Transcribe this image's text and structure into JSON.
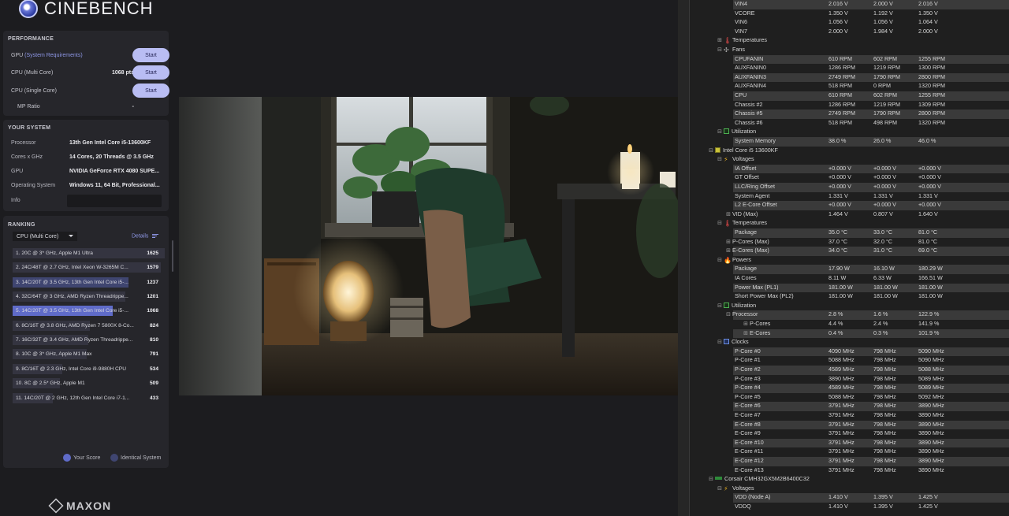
{
  "cinebench": {
    "brand": "CINEBENCH",
    "footer_brand": "MAXON",
    "performance": {
      "title": "PERFORMANCE",
      "rows": [
        {
          "label_main": "GPU ",
          "label_link": "(System Requirements)",
          "value": "-",
          "button": "Start"
        },
        {
          "label_main": "CPU (Multi Core)",
          "label_link": "",
          "value": "1068 pts",
          "button": "Start"
        },
        {
          "label_main": "CPU (Single Core)",
          "label_link": "",
          "value": "-",
          "button": "Start"
        },
        {
          "label_main": "MP Ratio",
          "label_link": "",
          "value": "-",
          "button": ""
        }
      ]
    },
    "system": {
      "title": "YOUR SYSTEM",
      "rows": [
        {
          "key": "Processor",
          "value": "13th Gen Intel Core i5-13600KF"
        },
        {
          "key": "Cores x GHz",
          "value": "14 Cores, 20 Threads @ 3.5 GHz"
        },
        {
          "key": "GPU",
          "value": "NVIDIA GeForce RTX 4080 SUPE..."
        },
        {
          "key": "Operating System",
          "value": "Windows 11, 64 Bit, Professional..."
        },
        {
          "key": "Info",
          "value": ""
        }
      ]
    },
    "ranking": {
      "title": "RANKING",
      "dropdown": "CPU (Multi Core)",
      "details": "Details",
      "rows": [
        {
          "name": "1. 20C @ 3* GHz, Apple M1 Ultra",
          "score": "1625",
          "kind": "other"
        },
        {
          "name": "2. 24C/48T @ 2.7 GHz, Intel Xeon W-3265M C...",
          "score": "1579",
          "kind": "other"
        },
        {
          "name": "3. 14C/20T @ 3.5 GHz, 13th Gen Intel Core i5-...",
          "score": "1237",
          "kind": "ident"
        },
        {
          "name": "4. 32C/64T @ 3 GHz, AMD Ryzen Threadrippe...",
          "score": "1201",
          "kind": "other"
        },
        {
          "name": "5. 14C/20T @ 3.5 GHz, 13th Gen Intel Core i5-...",
          "score": "1068",
          "kind": "me"
        },
        {
          "name": "6. 8C/16T @ 3.8 GHz, AMD Ryzen 7 5800X 8-Co...",
          "score": "824",
          "kind": "other"
        },
        {
          "name": "7. 16C/32T @ 3.4 GHz, AMD Ryzen Threadrippe...",
          "score": "810",
          "kind": "other"
        },
        {
          "name": "8. 10C @ 3* GHz, Apple M1 Max",
          "score": "791",
          "kind": "other"
        },
        {
          "name": "9. 8C/16T @ 2.3 GHz, Intel Core i9-9880H CPU",
          "score": "534",
          "kind": "other"
        },
        {
          "name": "10. 8C @ 2.5* GHz, Apple M1",
          "score": "509",
          "kind": "other"
        },
        {
          "name": "11. 14C/20T @ 2 GHz, 12th Gen Intel Core i7-1...",
          "score": "433",
          "kind": "other"
        }
      ],
      "legend_your_score": "Your Score",
      "legend_identical": "Identical System"
    }
  },
  "hwinfo": {
    "rows": [
      {
        "indent": 4,
        "label": "VIN4",
        "v1": "2.016 V",
        "v2": "2.000 V",
        "v3": "2.016 V",
        "icon": "",
        "toggle": "",
        "sel": true
      },
      {
        "indent": 4,
        "label": "VCORE",
        "v1": "1.350 V",
        "v2": "1.192 V",
        "v3": "1.350 V",
        "icon": "",
        "toggle": ""
      },
      {
        "indent": 4,
        "label": "VIN6",
        "v1": "1.056 V",
        "v2": "1.056 V",
        "v3": "1.064 V",
        "icon": "",
        "toggle": ""
      },
      {
        "indent": 4,
        "label": "VIN7",
        "v1": "2.000 V",
        "v2": "1.984 V",
        "v3": "2.000 V",
        "icon": "",
        "toggle": ""
      },
      {
        "indent": 2,
        "label": "Temperatures",
        "icon": "therm",
        "toggle": "+"
      },
      {
        "indent": 2,
        "label": "Fans",
        "icon": "fan",
        "toggle": "−"
      },
      {
        "indent": 4,
        "label": "CPUFANIN",
        "v1": "610 RPM",
        "v2": "602 RPM",
        "v3": "1255 RPM",
        "sel": true
      },
      {
        "indent": 4,
        "label": "AUXFANIN0",
        "v1": "1286 RPM",
        "v2": "1219 RPM",
        "v3": "1300 RPM"
      },
      {
        "indent": 4,
        "label": "AUXFANIN3",
        "v1": "2749 RPM",
        "v2": "1790 RPM",
        "v3": "2800 RPM",
        "sel": true
      },
      {
        "indent": 4,
        "label": "AUXFANIN4",
        "v1": "518 RPM",
        "v2": "0 RPM",
        "v3": "1320 RPM"
      },
      {
        "indent": 4,
        "label": "CPU",
        "v1": "610 RPM",
        "v2": "602 RPM",
        "v3": "1255 RPM",
        "sel": true
      },
      {
        "indent": 4,
        "label": "Chassis #2",
        "v1": "1286 RPM",
        "v2": "1219 RPM",
        "v3": "1309 RPM"
      },
      {
        "indent": 4,
        "label": "Chassis #5",
        "v1": "2749 RPM",
        "v2": "1790 RPM",
        "v3": "2800 RPM",
        "sel": true
      },
      {
        "indent": 4,
        "label": "Chassis #6",
        "v1": "518 RPM",
        "v2": "498 RPM",
        "v3": "1320 RPM"
      },
      {
        "indent": 2,
        "label": "Utilization",
        "icon": "util",
        "toggle": "−"
      },
      {
        "indent": 4,
        "label": "System Memory",
        "v1": "38.0 %",
        "v2": "26.0 %",
        "v3": "46.0 %",
        "sel": true
      },
      {
        "indent": 1,
        "label": "Intel Core i5 13600KF",
        "icon": "cpu",
        "toggle": "−"
      },
      {
        "indent": 2,
        "label": "Voltages",
        "icon": "volt",
        "toggle": "−"
      },
      {
        "indent": 4,
        "label": "IA Offset",
        "v1": "+0.000 V",
        "v2": "+0.000 V",
        "v3": "+0.000 V",
        "sel": true
      },
      {
        "indent": 4,
        "label": "GT Offset",
        "v1": "+0.000 V",
        "v2": "+0.000 V",
        "v3": "+0.000 V"
      },
      {
        "indent": 4,
        "label": "LLC/Ring Offset",
        "v1": "+0.000 V",
        "v2": "+0.000 V",
        "v3": "+0.000 V",
        "sel": true
      },
      {
        "indent": 4,
        "label": "System Agent",
        "v1": "1.331 V",
        "v2": "1.331 V",
        "v3": "1.331 V"
      },
      {
        "indent": 4,
        "label": "L2 E-Core Offset",
        "v1": "+0.000 V",
        "v2": "+0.000 V",
        "v3": "+0.000 V",
        "sel": true
      },
      {
        "indent": 3,
        "label": "VID (Max)",
        "v1": "1.464 V",
        "v2": "0.807 V",
        "v3": "1.640 V",
        "toggle": "+"
      },
      {
        "indent": 2,
        "label": "Temperatures",
        "icon": "therm",
        "toggle": "−"
      },
      {
        "indent": 4,
        "label": "Package",
        "v1": "35.0 °C",
        "v2": "33.0 °C",
        "v3": "81.0 °C",
        "sel": true
      },
      {
        "indent": 3,
        "label": "P-Cores (Max)",
        "v1": "37.0 °C",
        "v2": "32.0 °C",
        "v3": "81.0 °C",
        "toggle": "+"
      },
      {
        "indent": 3,
        "label": "E-Cores (Max)",
        "v1": "34.0 °C",
        "v2": "31.0 °C",
        "v3": "69.0 °C",
        "toggle": "+",
        "sel": true
      },
      {
        "indent": 2,
        "label": "Powers",
        "icon": "power",
        "toggle": "−"
      },
      {
        "indent": 4,
        "label": "Package",
        "v1": "17.90 W",
        "v2": "16.10 W",
        "v3": "180.29 W",
        "sel": true
      },
      {
        "indent": 4,
        "label": "IA Cores",
        "v1": "8.11 W",
        "v2": "6.33 W",
        "v3": "166.51 W"
      },
      {
        "indent": 4,
        "label": "Power Max (PL1)",
        "v1": "181.00 W",
        "v2": "181.00 W",
        "v3": "181.00 W",
        "sel": true
      },
      {
        "indent": 4,
        "label": "Short Power Max (PL2)",
        "v1": "181.00 W",
        "v2": "181.00 W",
        "v3": "181.00 W"
      },
      {
        "indent": 2,
        "label": "Utilization",
        "icon": "util",
        "toggle": "−"
      },
      {
        "indent": 3,
        "label": "Processor",
        "v1": "2.8 %",
        "v2": "1.6 %",
        "v3": "122.9 %",
        "toggle": "−",
        "sel": true
      },
      {
        "indent": 5,
        "label": "P-Cores",
        "v1": "4.4 %",
        "v2": "2.4 %",
        "v3": "141.9 %",
        "toggle": "+"
      },
      {
        "indent": 5,
        "label": "E-Cores",
        "v1": "0.4 %",
        "v2": "0.3 %",
        "v3": "101.9 %",
        "toggle": "+",
        "sel": true
      },
      {
        "indent": 2,
        "label": "Clocks",
        "icon": "clock",
        "toggle": "−"
      },
      {
        "indent": 4,
        "label": "P-Core #0",
        "v1": "4090 MHz",
        "v2": "798 MHz",
        "v3": "5090 MHz",
        "sel": true
      },
      {
        "indent": 4,
        "label": "P-Core #1",
        "v1": "5088 MHz",
        "v2": "798 MHz",
        "v3": "5090 MHz"
      },
      {
        "indent": 4,
        "label": "P-Core #2",
        "v1": "4589 MHz",
        "v2": "798 MHz",
        "v3": "5088 MHz",
        "sel": true
      },
      {
        "indent": 4,
        "label": "P-Core #3",
        "v1": "3890 MHz",
        "v2": "798 MHz",
        "v3": "5089 MHz"
      },
      {
        "indent": 4,
        "label": "P-Core #4",
        "v1": "4589 MHz",
        "v2": "798 MHz",
        "v3": "5089 MHz",
        "sel": true
      },
      {
        "indent": 4,
        "label": "P-Core #5",
        "v1": "5088 MHz",
        "v2": "798 MHz",
        "v3": "5092 MHz"
      },
      {
        "indent": 4,
        "label": "E-Core #6",
        "v1": "3791 MHz",
        "v2": "798 MHz",
        "v3": "3890 MHz",
        "sel": true
      },
      {
        "indent": 4,
        "label": "E-Core #7",
        "v1": "3791 MHz",
        "v2": "798 MHz",
        "v3": "3890 MHz"
      },
      {
        "indent": 4,
        "label": "E-Core #8",
        "v1": "3791 MHz",
        "v2": "798 MHz",
        "v3": "3890 MHz",
        "sel": true
      },
      {
        "indent": 4,
        "label": "E-Core #9",
        "v1": "3791 MHz",
        "v2": "798 MHz",
        "v3": "3890 MHz"
      },
      {
        "indent": 4,
        "label": "E-Core #10",
        "v1": "3791 MHz",
        "v2": "798 MHz",
        "v3": "3890 MHz",
        "sel": true
      },
      {
        "indent": 4,
        "label": "E-Core #11",
        "v1": "3791 MHz",
        "v2": "798 MHz",
        "v3": "3890 MHz"
      },
      {
        "indent": 4,
        "label": "E-Core #12",
        "v1": "3791 MHz",
        "v2": "798 MHz",
        "v3": "3890 MHz",
        "sel": true
      },
      {
        "indent": 4,
        "label": "E-Core #13",
        "v1": "3791 MHz",
        "v2": "798 MHz",
        "v3": "3890 MHz"
      },
      {
        "indent": 1,
        "label": "Corsair CMH32GX5M2B6400C32",
        "icon": "ram",
        "toggle": "−"
      },
      {
        "indent": 2,
        "label": "Voltages",
        "icon": "volt",
        "toggle": "−"
      },
      {
        "indent": 4,
        "label": "VDD (Node A)",
        "v1": "1.410 V",
        "v2": "1.395 V",
        "v3": "1.425 V",
        "sel": true
      },
      {
        "indent": 4,
        "label": "VDDQ",
        "v1": "1.410 V",
        "v2": "1.395 V",
        "v3": "1.425 V"
      }
    ]
  }
}
